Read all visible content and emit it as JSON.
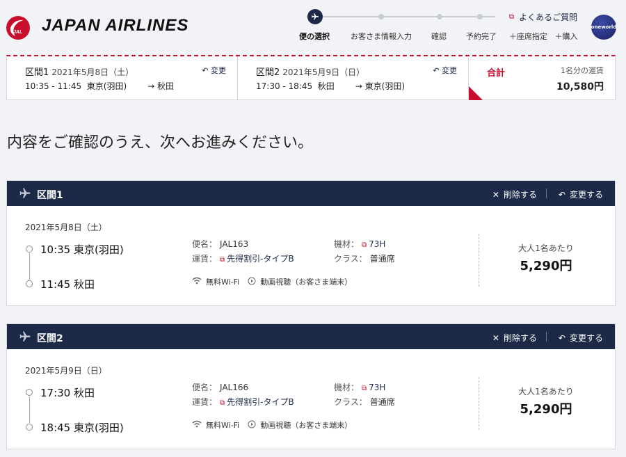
{
  "header": {
    "brand": "JAPAN AIRLINES",
    "logo_text": "JAL",
    "steps": [
      "便の選択",
      "お客さま情報入力",
      "確認",
      "予約完了"
    ],
    "active_step": 0,
    "faq_label": "よくあるご質問",
    "seat_label": "＋座席指定",
    "purchase_label": "＋購入",
    "alliance": "oneworld"
  },
  "summary": {
    "segments": [
      {
        "label": "区間1",
        "date": "2021年5月8日（土）",
        "time": "10:35 - 11:45",
        "from": "東京(羽田)",
        "to": "→ 秋田",
        "change": "変更"
      },
      {
        "label": "区間2",
        "date": "2021年5月9日（日）",
        "time": "17:30 - 18:45",
        "from": "秋田",
        "to": "→ 東京(羽田)",
        "change": "変更"
      }
    ],
    "total_label": "合計",
    "fare_label": "1名分の運賃",
    "fare_amount": "10,580円"
  },
  "headline": "内容をご確認のうえ、次へお進みください。",
  "segments": [
    {
      "name": "区間1",
      "delete": "削除する",
      "change": "変更する",
      "date": "2021年5月8日（土）",
      "dep": "10:35 東京(羽田)",
      "arr": "11:45 秋田",
      "flight_key": "便名：",
      "flight": "JAL163",
      "fare_key": "運賃：",
      "fare": "先得割引-タイプB",
      "aircraft_key": "機材：",
      "aircraft": "73H",
      "class_key": "クラス：",
      "class": "普通席",
      "wifi": "無料Wi-Fi",
      "video": "動画視聴（お客さま端末）",
      "per": "大人1名あたり",
      "price": "5,290円"
    },
    {
      "name": "区間2",
      "delete": "削除する",
      "change": "変更する",
      "date": "2021年5月9日（日）",
      "dep": "17:30 秋田",
      "arr": "18:45 東京(羽田)",
      "flight_key": "便名：",
      "flight": "JAL166",
      "fare_key": "運賃：",
      "fare": "先得割引-タイプB",
      "aircraft_key": "機材：",
      "aircraft": "73H",
      "class_key": "クラス：",
      "class": "普通席",
      "wifi": "無料Wi-Fi",
      "video": "動画視聴（お客さま端末）",
      "per": "大人1名あたり",
      "price": "5,290円"
    }
  ],
  "colors": {
    "navy": "#1c2a48",
    "red": "#c8102e"
  }
}
